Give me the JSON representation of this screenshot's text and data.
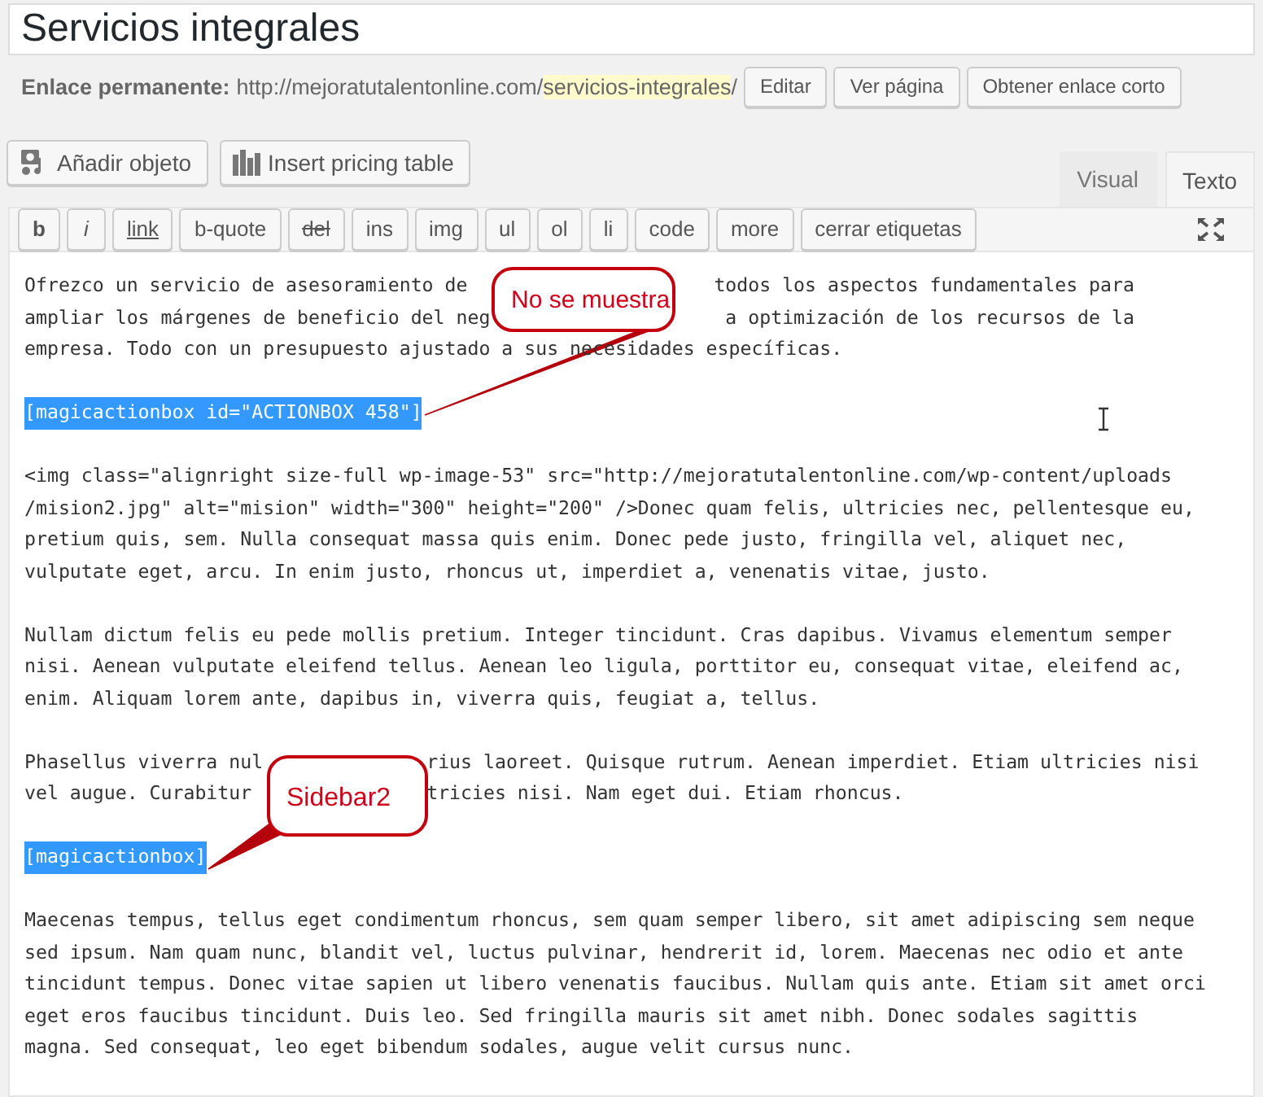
{
  "title": "Servicios integrales",
  "permalink": {
    "label": "Enlace permanente:",
    "base": "http://mejoratutalentonline.com/",
    "slug": "servicios-integrales",
    "trail": "/",
    "buttons": [
      "Editar",
      "Ver página",
      "Obtener enlace corto"
    ]
  },
  "media_buttons": [
    {
      "label": "Añadir objeto",
      "kind": "media"
    },
    {
      "label": "Insert pricing table",
      "kind": "chart"
    }
  ],
  "tabs": [
    {
      "label": "Visual",
      "selected": false
    },
    {
      "label": "Texto",
      "selected": true
    }
  ],
  "quicktags": [
    {
      "label": "b",
      "kind": "bold"
    },
    {
      "label": "i",
      "kind": "italic"
    },
    {
      "label": "link",
      "kind": "link"
    },
    {
      "label": "b-quote",
      "kind": "plain"
    },
    {
      "label": "del",
      "kind": "del"
    },
    {
      "label": "ins",
      "kind": "plain"
    },
    {
      "label": "img",
      "kind": "plain"
    },
    {
      "label": "ul",
      "kind": "plain"
    },
    {
      "label": "ol",
      "kind": "plain"
    },
    {
      "label": "li",
      "kind": "plain"
    },
    {
      "label": "code",
      "kind": "plain"
    },
    {
      "label": "more",
      "kind": "plain"
    },
    {
      "label": "cerrar etiquetas",
      "kind": "plain"
    }
  ],
  "content": [
    {
      "kind": "text",
      "callout": {
        "text": "No se muestra"
      },
      "lines": [
        [
          "Ofrezco un servicio de asesoramiento de ",
          "todos los aspectos fundamentales para"
        ],
        [
          "ampliar los márgenes de beneficio del neg",
          "a optimización de los recursos de la"
        ],
        [
          "empresa. Todo con un presupuesto ajustado a sus necesidades específicas."
        ]
      ]
    },
    {
      "kind": "shortcode",
      "text": "[magicactionbox id=\"ACTIONBOX 458\"]",
      "selected": true
    },
    {
      "kind": "text",
      "lines": [
        [
          "<img class=\"alignright size-full wp-image-53\" src=\"http://mejoratutalentonline.com/wp-content/uploads"
        ],
        [
          "/mision2.jpg\" alt=\"mision\" width=\"300\" height=\"200\" />Donec quam felis, ultricies nec, pellentesque eu,"
        ],
        [
          "pretium quis, sem. Nulla consequat massa quis enim. Donec pede justo, fringilla vel, aliquet nec,"
        ],
        [
          "vulputate eget, arcu. In enim justo, rhoncus ut, imperdiet a, venenatis vitae, justo."
        ]
      ]
    },
    {
      "kind": "text",
      "lines": [
        [
          "Nullam dictum felis eu pede mollis pretium. Integer tincidunt. Cras dapibus. Vivamus elementum semper"
        ],
        [
          "nisi. Aenean vulputate eleifend tellus. Aenean leo ligula, porttitor eu, consequat vitae, eleifend ac,"
        ],
        [
          "enim. Aliquam lorem ante, dapibus in, viverra quis, feugiat a, tellus."
        ]
      ]
    },
    {
      "kind": "text",
      "callout": {
        "text": "Sidebar2"
      },
      "lines": [
        [
          "Phasellus viverra nul",
          "rius laoreet. Quisque rutrum. Aenean imperdiet. Etiam ultricies nisi"
        ],
        [
          "vel augue. Curabitur ",
          "tricies nisi. Nam eget dui. Etiam rhoncus."
        ]
      ]
    },
    {
      "kind": "shortcode",
      "text": "[magicactionbox]",
      "selected": true
    },
    {
      "kind": "text",
      "lines": [
        [
          "Maecenas tempus, tellus eget condimentum rhoncus, sem quam semper libero, sit amet adipiscing sem neque"
        ],
        [
          "sed ipsum. Nam quam nunc, blandit vel, luctus pulvinar, hendrerit id, lorem. Maecenas nec odio et ante"
        ],
        [
          "tincidunt tempus. Donec vitae sapien ut libero venenatis faucibus. Nullam quis ante. Etiam sit amet orci"
        ],
        [
          "eget eros faucibus tincidunt. Duis leo. Sed fringilla mauris sit amet nibh. Donec sodales sagittis"
        ],
        [
          "magna. Sed consequat, leo eget bibendum sodales, augue velit cursus nunc."
        ]
      ]
    }
  ]
}
